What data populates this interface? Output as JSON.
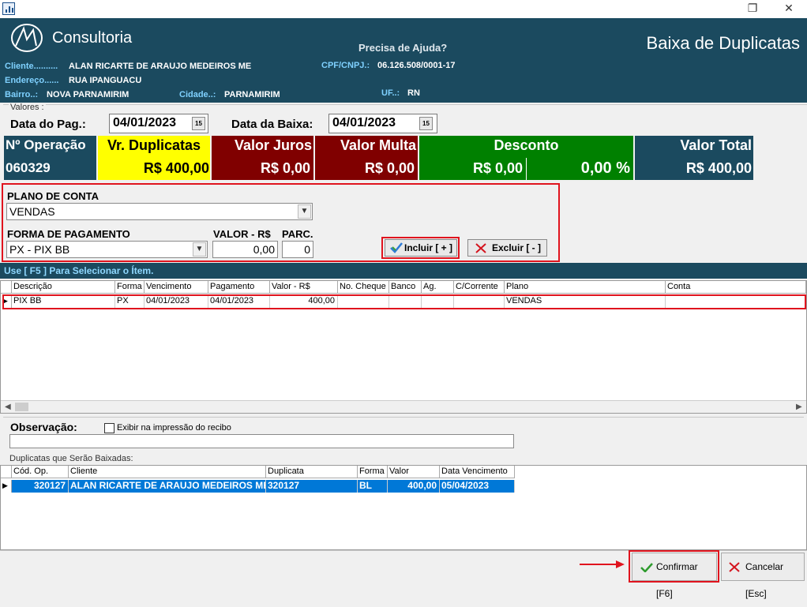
{
  "titlebar": {
    "restore_glyph": "❐",
    "close_glyph": "✕"
  },
  "header": {
    "logo_text": "Consultoria",
    "help_text": "Precisa de Ajuda?",
    "title": "Baixa de Duplicatas",
    "cliente_label": "Cliente..........",
    "cliente_value": "ALAN RICARTE DE ARAUJO MEDEIROS  ME",
    "cpf_label": "CPF/CNPJ.:",
    "cpf_value": "06.126.508/0001-17",
    "endereco_label": "Endereço......",
    "endereco_value": "RUA IPANGUACU",
    "bairro_label": "Bairro..:",
    "bairro_value": "NOVA PARNAMIRIM",
    "cidade_label": "Cidade..:",
    "cidade_value": "PARNAMIRIM",
    "uf_label": "UF..:",
    "uf_value": "RN"
  },
  "valores": {
    "caption": "Valores :",
    "data_pag_label": "Data do Pag.:",
    "data_pag_value": "04/01/2023",
    "data_baixa_label": "Data da Baixa:",
    "data_baixa_value": "04/01/2023",
    "cal_glyph": "15"
  },
  "tiles": {
    "operacao_label": "Nº Operação",
    "operacao_value": "060329",
    "duplicatas_label": "Vr. Duplicatas",
    "duplicatas_value": "R$ 400,00",
    "juros_label": "Valor Juros",
    "juros_value": "R$ 0,00",
    "multa_label": "Valor Multa",
    "multa_value": "R$ 0,00",
    "desconto_label": "Desconto",
    "desconto_value": "R$ 0,00",
    "desconto_pct": "0,00 %",
    "total_label": "Valor Total",
    "total_value": "R$ 400,00",
    "colors": {
      "navy": "#1b4a5f",
      "yellow": "#ffff00",
      "maroon": "#800000",
      "green": "#008000"
    }
  },
  "form": {
    "plano_label": "PLANO DE CONTA",
    "plano_value": "VENDAS",
    "forma_label": "FORMA DE PAGAMENTO",
    "forma_value": "PX - PIX BB",
    "valor_label": "VALOR - R$",
    "valor_value": "0,00",
    "parc_label": "PARC.",
    "parc_value": "0",
    "incluir_label": "Incluir [ + ]",
    "excluir_label": "Excluir [ - ]"
  },
  "hint_bar": "Use [ F5 ] Para Selecionar o Ítem.",
  "payments": {
    "columns": [
      "Descrição",
      "Forma",
      "Vencimento",
      "Pagamento",
      "Valor - R$",
      "No. Cheque",
      "Banco",
      "Ag.",
      "C/Corrente",
      "Plano",
      "Conta"
    ],
    "rows": [
      [
        "PIX BB",
        "PX",
        "04/01/2023",
        "04/01/2023",
        "400,00",
        "",
        "",
        "",
        "",
        "VENDAS",
        ""
      ]
    ]
  },
  "observacao": {
    "label": "Observação:",
    "checkbox_label": "Exibir na impressão do recibo",
    "value": ""
  },
  "duplicatas": {
    "caption": "Duplicatas que Serão Baixadas:",
    "columns": [
      "Cód. Op.",
      "Cliente",
      "Duplicata",
      "Forma",
      "Valor",
      "Data Vencimento"
    ],
    "rows": [
      [
        "320127",
        "ALAN RICARTE DE ARAUJO MEDEIROS  ME",
        "320127",
        "BL",
        "400,00",
        "05/04/2023"
      ]
    ],
    "selected_color": "#0078d7"
  },
  "footer": {
    "confirmar_label": "Confirmar [F6]",
    "cancelar_label": "Cancelar [Esc]"
  }
}
